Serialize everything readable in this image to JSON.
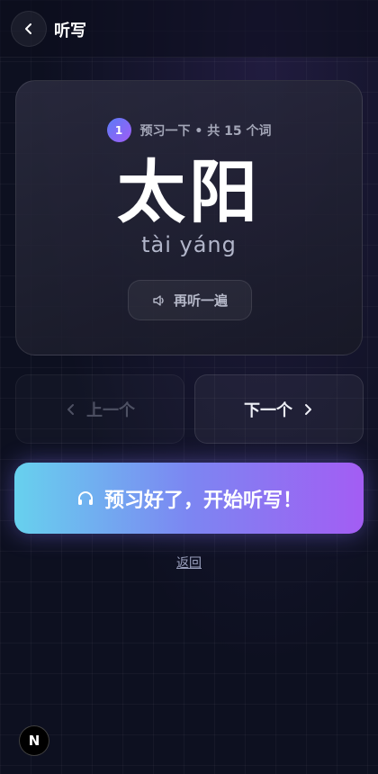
{
  "header": {
    "title": "听写",
    "back_icon": "chevron-left-icon"
  },
  "card": {
    "index": "1",
    "progress_text": "预习一下 • 共 15 个词",
    "word": "太阳",
    "pinyin": "tài yáng",
    "replay_label": "再听一遍",
    "replay_icon": "speaker-icon"
  },
  "nav": {
    "prev_label": "上一个",
    "next_label": "下一个",
    "prev_icon": "chevron-left-icon",
    "next_icon": "chevron-right-icon",
    "prev_enabled": false
  },
  "start": {
    "label": "预习好了，开始听写！",
    "icon": "headphones-icon"
  },
  "back_link": "返回",
  "badge": {
    "label": "N"
  },
  "colors": {
    "background": "#0d1020",
    "gradient_start": "#67d1ee",
    "gradient_end": "#a35df3",
    "badge_start": "#5b7cf7",
    "badge_end": "#a15cf5"
  }
}
